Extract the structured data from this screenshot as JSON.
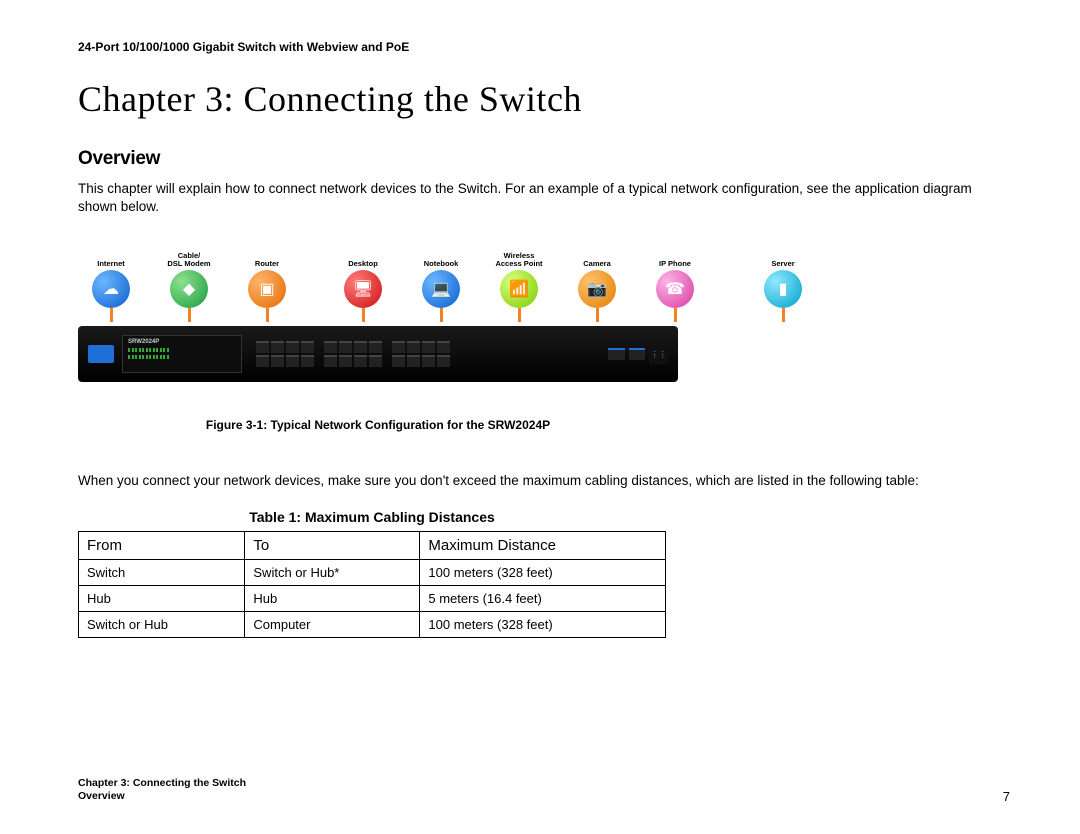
{
  "header": "24-Port 10/100/1000 Gigabit Switch with Webview and PoE",
  "chapter_title": "Chapter 3: Connecting the Switch",
  "section_heading": "Overview",
  "intro_text": "This chapter will explain how to connect network devices to the Switch. For an example of a typical network configuration, see the application diagram shown below.",
  "diagram": {
    "devices": [
      {
        "label": "Internet",
        "color": "c-blue",
        "glyph": "☁"
      },
      {
        "label": "Cable/\nDSL Modem",
        "color": "c-green",
        "glyph": "◆"
      },
      {
        "label": "Router",
        "color": "c-orange",
        "glyph": "▣"
      },
      {
        "label": "Desktop",
        "color": "c-red",
        "glyph": "🖥"
      },
      {
        "label": "Notebook",
        "color": "c-blue",
        "glyph": "💻"
      },
      {
        "label": "Wireless\nAccess Point",
        "color": "c-lime",
        "glyph": "📶"
      },
      {
        "label": "Camera",
        "color": "c-orange2",
        "glyph": "📷"
      },
      {
        "label": "IP Phone",
        "color": "c-pink",
        "glyph": "☎"
      },
      {
        "label": "Server",
        "color": "c-teal",
        "glyph": "▮"
      }
    ],
    "switch_model": "SRW2024P"
  },
  "figure_caption": "Figure 3-1: Typical Network Configuration for the SRW2024P",
  "pre_table_text": "When you connect your network devices, make sure you don't exceed the maximum cabling distances, which are listed in the following table:",
  "table": {
    "title": "Table 1: Maximum Cabling Distances",
    "headers": [
      "From",
      "To",
      "Maximum Distance"
    ],
    "rows": [
      [
        "Switch",
        "Switch or Hub*",
        "100 meters (328 feet)"
      ],
      [
        "Hub",
        "Hub",
        "5 meters (16.4 feet)"
      ],
      [
        "Switch or Hub",
        "Computer",
        "100 meters (328 feet)"
      ]
    ]
  },
  "footer": {
    "line1": "Chapter 3: Connecting the Switch",
    "line2": "Overview",
    "page": "7"
  }
}
